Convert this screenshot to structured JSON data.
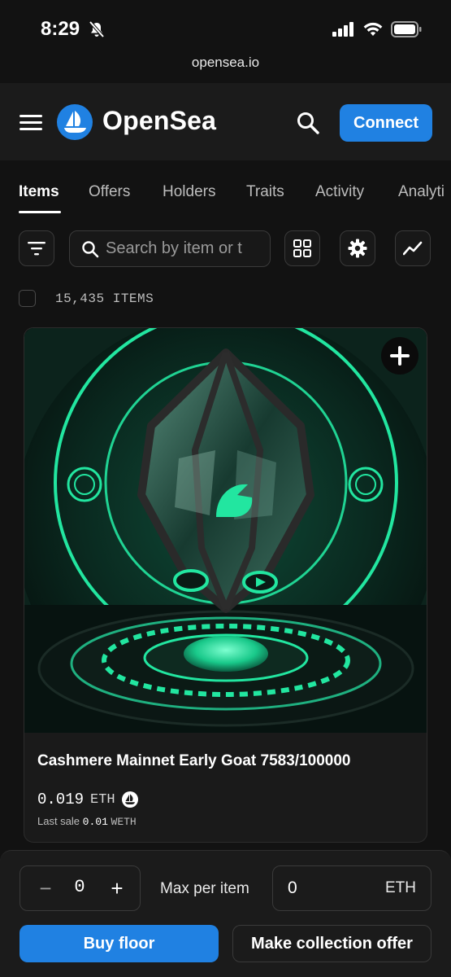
{
  "status_bar": {
    "time": "8:29",
    "url": "opensea.io"
  },
  "nav": {
    "brand": "OpenSea",
    "connect_label": "Connect"
  },
  "tabs": [
    {
      "label": "Items",
      "active": true
    },
    {
      "label": "Offers"
    },
    {
      "label": "Holders"
    },
    {
      "label": "Traits"
    },
    {
      "label": "Activity"
    },
    {
      "label": "Analyti"
    }
  ],
  "toolbar": {
    "search_placeholder": "Search by item or t"
  },
  "items": {
    "count_label": "15,435 ITEMS"
  },
  "card": {
    "title": "Cashmere Mainnet Early Goat 7583/100000",
    "price": "0.019",
    "currency": "ETH",
    "last_sale_label": "Last sale",
    "last_sale_value": "0.01",
    "last_sale_currency": "WETH"
  },
  "bottom": {
    "minus": "−",
    "quantity": "0",
    "plus": "+",
    "max_label": "Max per item",
    "price_value": "0",
    "price_unit": "ETH",
    "buy_label": "Buy floor",
    "offer_label": "Make collection offer"
  },
  "colors": {
    "accent": "#2081e2",
    "background": "#121212",
    "glow": "#22e6a0"
  }
}
